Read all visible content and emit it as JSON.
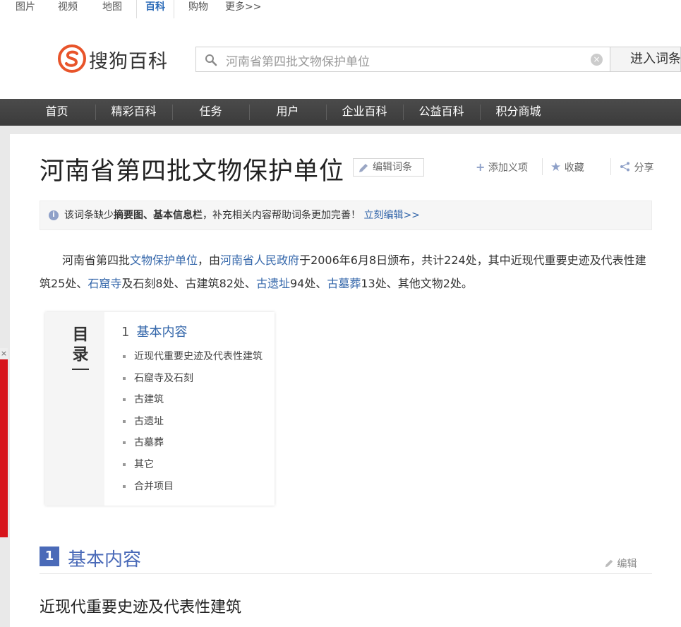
{
  "topnav": {
    "tabs": [
      "图片",
      "视频",
      "地图",
      "百科",
      "购物",
      "更多>>"
    ],
    "active": "百科"
  },
  "header": {
    "logo_text": "搜狗百科",
    "search_value": "河南省第四批文物保护单位",
    "search_button": "进入词条"
  },
  "mainnav": [
    "首页",
    "精彩百科",
    "任务",
    "用户",
    "企业百科",
    "公益百科",
    "积分商城"
  ],
  "article": {
    "title": "河南省第四批文物保护单位",
    "edit_entry": "编辑词条",
    "actions": {
      "add_meaning": "添加义项",
      "favorite": "收藏",
      "share": "分享"
    },
    "notice": {
      "prefix": "该词条缺少",
      "bold": "摘要图、基本信息栏",
      "suffix": "，补充相关内容帮助词条更加完善！",
      "link": "立刻编辑>>"
    },
    "summary": {
      "t1": "河南省第四批",
      "l1": "文物保护单位",
      "t2": "，由",
      "l2": "河南省人民政府",
      "t3": "于2006年6月8日颁布，共计224处，其中近现代重要史迹及代表性建筑25处、",
      "l3": "石窟寺",
      "t4": "及石刻8处、古建筑82处、",
      "l4": "古遗址",
      "t5": "94处、",
      "l5": "古墓葬",
      "t6": "13处、其他文物2处。"
    },
    "toc": {
      "label": "目录",
      "heading_num": "1",
      "heading": "基本内容",
      "items": [
        "近现代重要史迹及代表性建筑",
        "石窟寺及石刻",
        "古建筑",
        "古遗址",
        "古墓葬",
        "其它",
        "合并项目"
      ]
    },
    "section": {
      "num": "1",
      "title": "基本内容",
      "edit": "编辑",
      "subtitle": "近现代重要史迹及代表性建筑"
    }
  }
}
